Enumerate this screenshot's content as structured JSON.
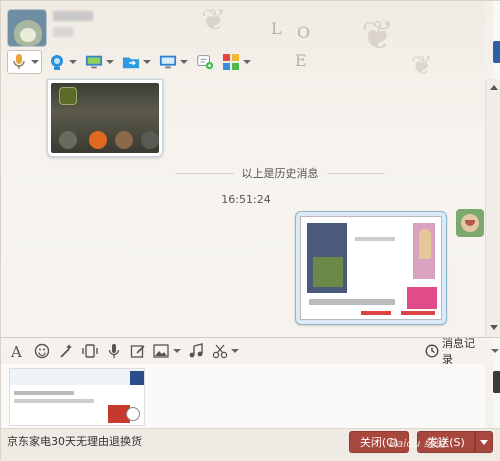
{
  "window": {
    "contact_name": "",
    "accent_color": "#a7473e",
    "background_color": "#f4f1ec"
  },
  "header": {
    "logo_letters": [
      "L",
      "O",
      "E"
    ]
  },
  "toolbar": {
    "icons": [
      "voice-call-icon",
      "video-call-icon",
      "remote-desktop-icon",
      "file-transfer-icon",
      "screen-share-icon",
      "message-add-icon",
      "apps-icon"
    ]
  },
  "chat": {
    "history_label": "以上是历史消息",
    "timestamp": "16:51:24"
  },
  "input_toolbar": {
    "icons": [
      "font-icon",
      "emoji-icon",
      "magic-icon",
      "shake-icon",
      "voice-message-icon",
      "edit-icon",
      "image-icon",
      "music-icon",
      "screenshot-icon"
    ],
    "history_button_label": "消息记录"
  },
  "footer": {
    "ad_text": "京东家电30天无理由退换货",
    "close_button_label": "关闭(C)",
    "send_button_label": "发送(S)",
    "watermark": "Baidu 经验"
  }
}
